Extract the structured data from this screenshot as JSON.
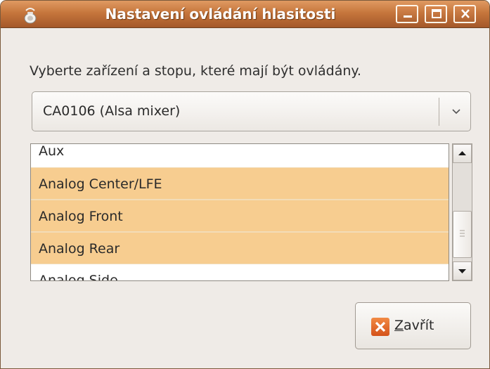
{
  "window": {
    "title": "Nastavení ovládání hlasitosti",
    "icon": "speaker-app-icon",
    "controls": [
      "minimize-icon",
      "maximize-icon",
      "close-icon"
    ]
  },
  "prompt": "Vyberte zařízení a stopu, které mají být ovládány.",
  "device": {
    "selected": "CA0106 (Alsa mixer)",
    "arrow_icon": "chevron-down-icon"
  },
  "tracks": {
    "items": [
      {
        "label": "Aux",
        "selected": false
      },
      {
        "label": "Analog Center/LFE",
        "selected": true
      },
      {
        "label": "Analog Front",
        "selected": true
      },
      {
        "label": "Analog Rear",
        "selected": true
      },
      {
        "label": "Analog Side",
        "selected": false
      }
    ],
    "selection_color": "#f7cd90"
  },
  "close_button": {
    "label_underlined": "Z",
    "label_rest": "avřít",
    "icon": "x-icon",
    "icon_color": "#e8692a"
  },
  "colors": {
    "titlebar": "#c6763c",
    "window_bg": "#efebe7"
  }
}
